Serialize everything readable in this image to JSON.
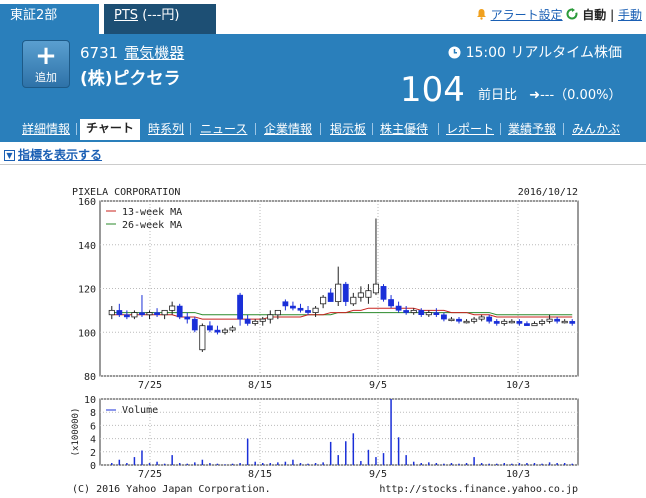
{
  "market_tabs": {
    "tse": "東証2部",
    "pts": "PTS",
    "pts_value": "(---円)"
  },
  "top_links": {
    "alert": "アラート設定",
    "auto": "自動",
    "separator": "|",
    "manual": "手動"
  },
  "stock": {
    "add_label": "追加",
    "code": "6731",
    "industry": "電気機器",
    "name": "(株)ピクセラ",
    "time": "15:00",
    "time_label": "リアルタイム株価",
    "price": "104",
    "change_label": "前日比",
    "change": "---",
    "change_pct": "（0.00%）"
  },
  "subnav": [
    "詳細情報",
    "チャート",
    "時系列",
    "ニュース",
    "企業情報",
    "掲示板",
    "株主優待",
    "レポート",
    "業績予報",
    "みんかぶ"
  ],
  "indicator_link": "指標を表示する",
  "colors": {
    "header": "#2a7fbb",
    "tab_dark": "#1d4f74",
    "link": "#1a5fb4",
    "up_candle": "#ffffff",
    "down_candle": "#1a2fd8",
    "ma13": "#c8231e",
    "ma26": "#2b8a2b",
    "volume": "#1a2fd8"
  },
  "chart_data": {
    "type": "candlestick",
    "title": "PIXELA CORPORATION",
    "date": "2016/10/12",
    "legend": [
      "13-week MA",
      "26-week MA"
    ],
    "ylim": [
      80,
      160
    ],
    "yticks": [
      80,
      100,
      120,
      140,
      160
    ],
    "xticks": [
      "7/25",
      "8/15",
      "9/5",
      "10/3"
    ],
    "candles": [
      {
        "o": 108,
        "h": 112,
        "l": 106,
        "c": 110
      },
      {
        "o": 110,
        "h": 113,
        "l": 107,
        "c": 108
      },
      {
        "o": 108,
        "h": 110,
        "l": 106,
        "c": 107
      },
      {
        "o": 107,
        "h": 110,
        "l": 106,
        "c": 109
      },
      {
        "o": 109,
        "h": 117,
        "l": 107,
        "c": 108
      },
      {
        "o": 108,
        "h": 110,
        "l": 106,
        "c": 109
      },
      {
        "o": 109,
        "h": 111,
        "l": 107,
        "c": 108
      },
      {
        "o": 108,
        "h": 110,
        "l": 106,
        "c": 110
      },
      {
        "o": 110,
        "h": 114,
        "l": 108,
        "c": 112
      },
      {
        "o": 112,
        "h": 113,
        "l": 106,
        "c": 107
      },
      {
        "o": 107,
        "h": 109,
        "l": 104,
        "c": 106
      },
      {
        "o": 106,
        "h": 107,
        "l": 100,
        "c": 101
      },
      {
        "o": 92,
        "h": 104,
        "l": 91,
        "c": 103
      },
      {
        "o": 103,
        "h": 105,
        "l": 100,
        "c": 101
      },
      {
        "o": 101,
        "h": 103,
        "l": 99,
        "c": 100
      },
      {
        "o": 100,
        "h": 102,
        "l": 99,
        "c": 101
      },
      {
        "o": 101,
        "h": 103,
        "l": 100,
        "c": 102
      },
      {
        "o": 117,
        "h": 118,
        "l": 103,
        "c": 106
      },
      {
        "o": 106,
        "h": 108,
        "l": 103,
        "c": 104
      },
      {
        "o": 104,
        "h": 106,
        "l": 103,
        "c": 105
      },
      {
        "o": 105,
        "h": 107,
        "l": 103,
        "c": 106
      },
      {
        "o": 106,
        "h": 110,
        "l": 104,
        "c": 108
      },
      {
        "o": 108,
        "h": 110,
        "l": 106,
        "c": 110
      },
      {
        "o": 114,
        "h": 115,
        "l": 110,
        "c": 112
      },
      {
        "o": 112,
        "h": 114,
        "l": 110,
        "c": 111
      },
      {
        "o": 111,
        "h": 113,
        "l": 109,
        "c": 110
      },
      {
        "o": 110,
        "h": 112,
        "l": 108,
        "c": 109
      },
      {
        "o": 109,
        "h": 112,
        "l": 107,
        "c": 111
      },
      {
        "o": 113,
        "h": 117,
        "l": 111,
        "c": 116
      },
      {
        "o": 118,
        "h": 120,
        "l": 114,
        "c": 114
      },
      {
        "o": 114,
        "h": 130,
        "l": 112,
        "c": 122
      },
      {
        "o": 122,
        "h": 123,
        "l": 112,
        "c": 114
      },
      {
        "o": 113,
        "h": 118,
        "l": 112,
        "c": 116
      },
      {
        "o": 116,
        "h": 121,
        "l": 114,
        "c": 118
      },
      {
        "o": 116,
        "h": 122,
        "l": 113,
        "c": 119
      },
      {
        "o": 118,
        "h": 152,
        "l": 117,
        "c": 122
      },
      {
        "o": 121,
        "h": 122,
        "l": 114,
        "c": 115
      },
      {
        "o": 115,
        "h": 117,
        "l": 111,
        "c": 112
      },
      {
        "o": 112,
        "h": 114,
        "l": 109,
        "c": 110
      },
      {
        "o": 110,
        "h": 112,
        "l": 108,
        "c": 109
      },
      {
        "o": 109,
        "h": 111,
        "l": 108,
        "c": 110
      },
      {
        "o": 110,
        "h": 111,
        "l": 107,
        "c": 108
      },
      {
        "o": 108,
        "h": 110,
        "l": 107,
        "c": 109
      },
      {
        "o": 109,
        "h": 111,
        "l": 107,
        "c": 108
      },
      {
        "o": 108,
        "h": 109,
        "l": 105,
        "c": 106
      },
      {
        "o": 106,
        "h": 107,
        "l": 105,
        "c": 106
      },
      {
        "o": 106,
        "h": 107,
        "l": 104,
        "c": 105
      },
      {
        "o": 105,
        "h": 106,
        "l": 104,
        "c": 105
      },
      {
        "o": 105,
        "h": 107,
        "l": 104,
        "c": 106
      },
      {
        "o": 106,
        "h": 108,
        "l": 105,
        "c": 107
      },
      {
        "o": 107,
        "h": 108,
        "l": 104,
        "c": 105
      },
      {
        "o": 105,
        "h": 106,
        "l": 103,
        "c": 104
      },
      {
        "o": 104,
        "h": 106,
        "l": 103,
        "c": 105
      },
      {
        "o": 105,
        "h": 106,
        "l": 104,
        "c": 105
      },
      {
        "o": 105,
        "h": 106,
        "l": 103,
        "c": 104
      },
      {
        "o": 104,
        "h": 105,
        "l": 103,
        "c": 103
      },
      {
        "o": 103,
        "h": 105,
        "l": 103,
        "c": 104
      },
      {
        "o": 104,
        "h": 106,
        "l": 103,
        "c": 105
      },
      {
        "o": 105,
        "h": 108,
        "l": 104,
        "c": 106
      },
      {
        "o": 106,
        "h": 107,
        "l": 104,
        "c": 105
      },
      {
        "o": 105,
        "h": 106,
        "l": 104,
        "c": 105
      },
      {
        "o": 105,
        "h": 106,
        "l": 103,
        "c": 104
      }
    ],
    "ma13": [
      108,
      108,
      108,
      108,
      108,
      108,
      108,
      108,
      108,
      107,
      107,
      107,
      106,
      106,
      106,
      106,
      106,
      106,
      106,
      106,
      106,
      107,
      107,
      107,
      107,
      107,
      108,
      108,
      108,
      109,
      109,
      109,
      110,
      110,
      111,
      111,
      111,
      111,
      111,
      111,
      111,
      110,
      110,
      110,
      110,
      109,
      109,
      109,
      108,
      108,
      108,
      107,
      107,
      107,
      107,
      107,
      107,
      107,
      107,
      107,
      107,
      107
    ],
    "ma26": [
      109,
      109,
      109,
      109,
      109,
      109,
      109,
      109,
      109,
      109,
      109,
      109,
      108,
      108,
      108,
      108,
      108,
      108,
      108,
      108,
      108,
      108,
      108,
      108,
      108,
      108,
      108,
      108,
      108,
      108,
      109,
      109,
      109,
      109,
      109,
      109,
      109,
      109,
      109,
      109,
      109,
      109,
      109,
      109,
      109,
      109,
      109,
      109,
      109,
      109,
      109,
      108,
      108,
      108,
      108,
      108,
      108,
      108,
      108,
      108,
      108,
      108
    ],
    "volume": {
      "label": "Volume",
      "unit": "(x100000)",
      "ylim": [
        0,
        10
      ],
      "yticks": [
        0,
        2,
        4,
        6,
        8,
        10
      ],
      "values": [
        0.3,
        0.8,
        0.3,
        1.2,
        2.2,
        0.3,
        0.5,
        0.2,
        1.5,
        0.3,
        0.2,
        0.4,
        0.8,
        0.3,
        0.2,
        0.1,
        0.2,
        0.3,
        4,
        0.5,
        0.3,
        0.3,
        0.4,
        0.5,
        0.8,
        0.3,
        0.2,
        0.3,
        0.4,
        3.5,
        1.5,
        3.6,
        4.8,
        0.6,
        2.3,
        1.2,
        1.8,
        10,
        4.2,
        1.5,
        0.5,
        0.3,
        0.4,
        0.3,
        0.2,
        0.3,
        0.2,
        0.3,
        1.2,
        0.3,
        0.2,
        0.2,
        0.3,
        0.2,
        0.3,
        0.3,
        0.3,
        0.2,
        0.4,
        0.3,
        0.3,
        0.2
      ]
    }
  },
  "footer": {
    "copyright": "(C) 2016 Yahoo Japan Corporation.",
    "url": "http://stocks.finance.yahoo.co.jp"
  }
}
